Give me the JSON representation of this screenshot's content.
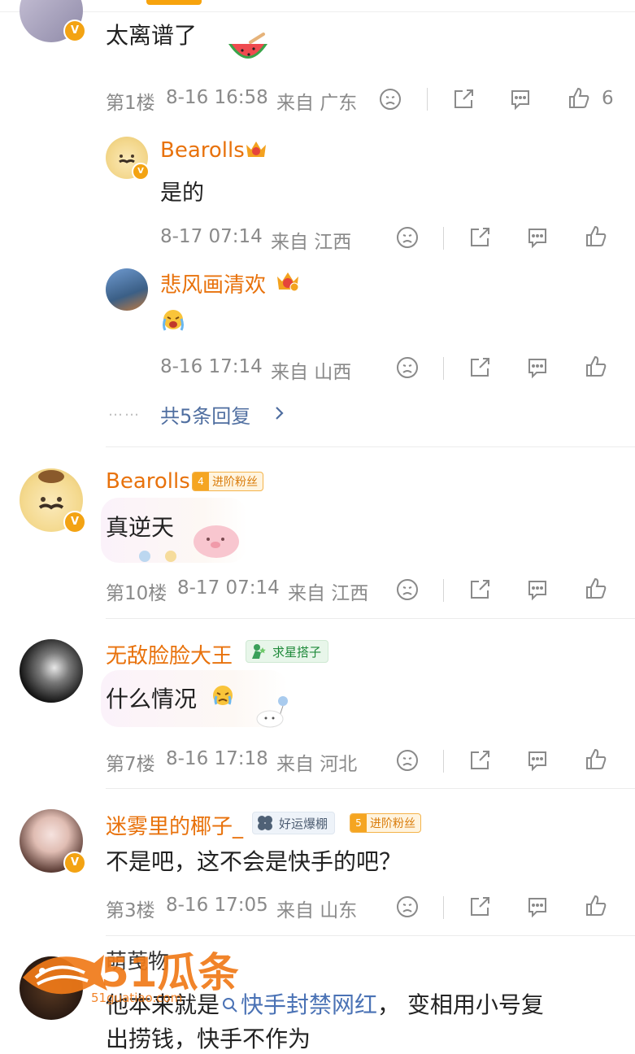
{
  "colors": {
    "accent": "#f7a30d",
    "username": "#e8720c",
    "link": "#4a72b5",
    "meta": "#8a8a8a"
  },
  "comments": [
    {
      "content": "太离谱了",
      "meta_floor": "第1楼",
      "meta_time": "8-16 16:58",
      "meta_loc": "来自 广东",
      "like_count": "6"
    },
    {
      "username": "Bearolls",
      "badge_level": "4",
      "badge_text": "进阶粉丝",
      "content": "真逆天",
      "meta_floor": "第10楼",
      "meta_time": "8-17 07:14",
      "meta_loc": "来自 江西"
    },
    {
      "username": "无敌脸脸大王",
      "badge_text": "求星搭子",
      "content": "什么情况",
      "meta_floor": "第7楼",
      "meta_time": "8-16 17:18",
      "meta_loc": "来自 河北"
    },
    {
      "username": "迷雾里的椰子_",
      "badge_text": "好运爆棚",
      "badge2_level": "5",
      "badge2_text": "进阶粉丝",
      "content": "不是吧，这不会是快手的吧？",
      "meta_floor": "第3楼",
      "meta_time": "8-16 17:05",
      "meta_loc": "来自 山东"
    },
    {
      "username_partial": "萌䒶物",
      "content_prefix": "他本来就是",
      "content_link": "快手封禁网红",
      "content_suffix": "，  变相用小号复",
      "content_line2": "出捞钱，快手不作为"
    }
  ],
  "replies": [
    {
      "username": "Bearolls",
      "content": "是的",
      "meta_time": "8-17 07:14",
      "meta_loc": "来自 江西"
    },
    {
      "username": "悲风画清欢",
      "content": "",
      "meta_time": "8-16 17:14",
      "meta_loc": "来自 山西"
    }
  ],
  "more_replies": "共5条回复",
  "more_dots": "……",
  "watermark": {
    "brand": "51瓜条",
    "url": "51guatiao.com"
  }
}
